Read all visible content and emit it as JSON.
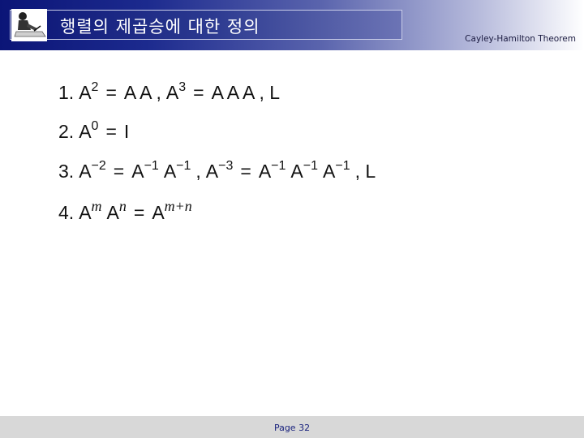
{
  "header": {
    "title": "행렬의 제곱승에 대한 정의",
    "subtitle": "Cayley-Hamilton Theorem",
    "logo_icon": "person-writing-icon"
  },
  "lines": [
    {
      "num": "1.",
      "parts": [
        {
          "base": "A",
          "exp": "2"
        },
        {
          "text": "="
        },
        {
          "text": "A A ,"
        },
        {
          "base": "A",
          "exp": "3"
        },
        {
          "text": "="
        },
        {
          "text": "A A A , L"
        }
      ]
    },
    {
      "num": "2.",
      "parts": [
        {
          "base": "A",
          "exp": "0"
        },
        {
          "text": "="
        },
        {
          "text": "I"
        }
      ]
    },
    {
      "num": "3.",
      "parts": [
        {
          "base": "A",
          "exp": "−2"
        },
        {
          "text": "="
        },
        {
          "base": "A",
          "exp": "−1"
        },
        {
          "base": "A",
          "exp": "−1"
        },
        {
          "text": ","
        },
        {
          "base": "A",
          "exp": "−3"
        },
        {
          "text": "="
        },
        {
          "base": "A",
          "exp": "−1"
        },
        {
          "base": "A",
          "exp": "−1"
        },
        {
          "base": "A",
          "exp": "−1"
        },
        {
          "text": ", L"
        }
      ]
    },
    {
      "num": "4.",
      "parts": [
        {
          "base": "A",
          "exp": "m",
          "italic": true
        },
        {
          "base": "A",
          "exp": "n",
          "italic": true
        },
        {
          "text": "="
        },
        {
          "base": "A",
          "exp": "m+n",
          "italic": true
        }
      ]
    }
  ],
  "footer": {
    "page": "Page 32"
  }
}
